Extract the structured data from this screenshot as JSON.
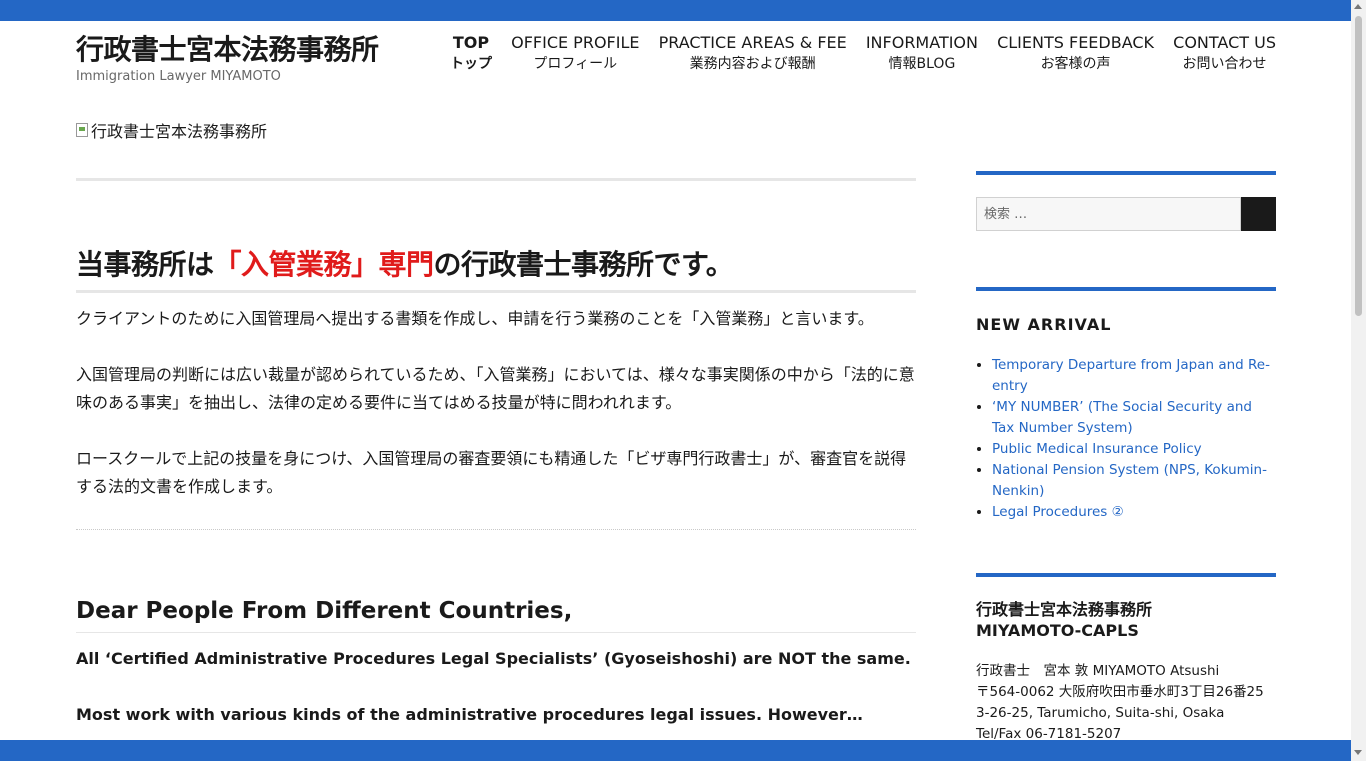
{
  "header": {
    "site_title": "行政書士宮本法務事務所",
    "site_description": "Immigration Lawyer MIYAMOTO",
    "header_image_alt": "行政書士宮本法務事務所"
  },
  "nav": {
    "items": [
      {
        "en": "TOP",
        "jp": "トップ"
      },
      {
        "en": "OFFICE PROFILE",
        "jp": "プロフィール"
      },
      {
        "en": "PRACTICE AREAS & FEE",
        "jp": "業務内容および報酬"
      },
      {
        "en": "INFORMATION",
        "jp": "情報BLOG"
      },
      {
        "en": "CLIENTS FEEDBACK",
        "jp": "お客様の声"
      },
      {
        "en": "CONTACT US",
        "jp": "お問い合わせ"
      }
    ]
  },
  "main": {
    "title_part1": "当事務所は",
    "title_red": "「入管業務」専門",
    "title_part2": "の行政書士事務所です。",
    "paragraphs": [
      "クライアントのために入国管理局へ提出する書類を作成し、申請を行う業務のことを「入管業務」と言います。",
      "入国管理局の判断には広い裁量が認められているため、「入管業務」においては、様々な事実関係の中から「法的に意味のある事実」を抽出し、法律の定める要件に当てはめる技量が特に問われれます。",
      "ロースクールで上記の技量を身につけ、入国管理局の審査要領にも精通した「ビザ専門行政書士」が、審査官を説得する法的文書を作成します。"
    ],
    "sub_title": "Dear People From Different Countries,",
    "bold_paragraphs": [
      "All ‘Certified Administrative Procedures Legal Specialists’ (Gyoseishoshi) are NOT the same.",
      "Most work with various kinds of the administrative procedures legal issues. However…"
    ]
  },
  "sidebar": {
    "search_placeholder": "検索 …",
    "new_arrival_title": "NEW ARRIVAL",
    "new_arrivals": [
      "Temporary Departure from Japan and Re-entry",
      "‘MY NUMBER’ (The Social Security and Tax Number System)",
      "Public Medical Insurance Policy",
      "National Pension System (NPS, Kokumin-Nenkin)",
      "Legal Procedures ②"
    ],
    "office_title_1": "行政書士宮本法務事務所",
    "office_title_2": "MIYAMOTO-CAPLS",
    "office_lines": [
      "行政書士　宮本 敦 MIYAMOTO Atsushi",
      "〒564-0062 大阪府吹田市垂水町3丁目26番25",
      "3-26-25, Tarumicho, Suita-shi, Osaka",
      "Tel/Fax 06-7181-5207"
    ]
  },
  "colors": {
    "accent": "#2467c5",
    "highlight_red": "#e01b1b",
    "text": "#1a1a1a"
  }
}
